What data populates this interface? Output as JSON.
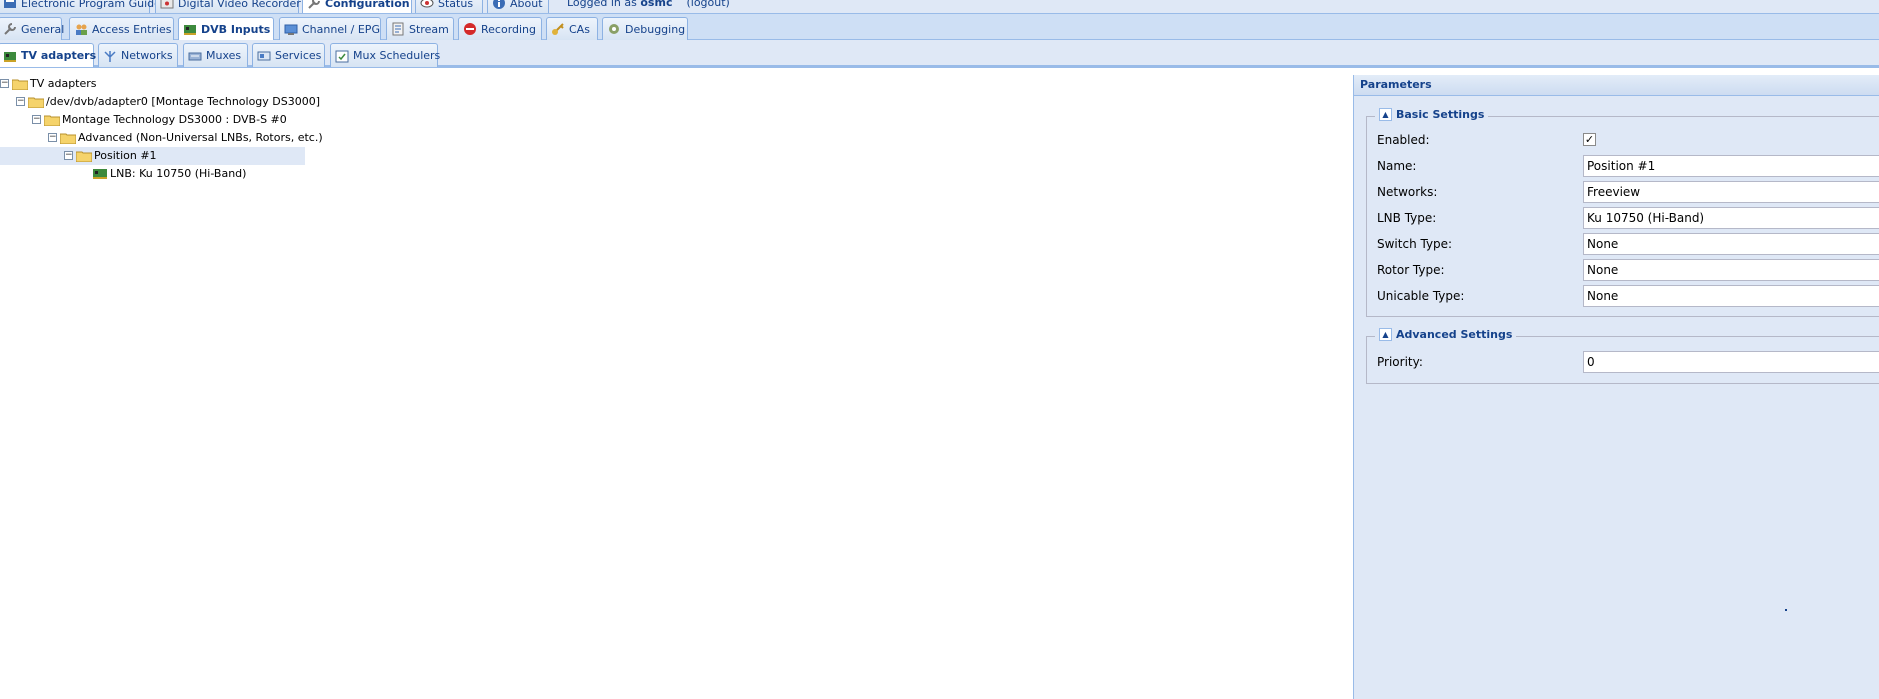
{
  "top_tabs": [
    {
      "label": "Electronic Program Guide",
      "icon": "epg-icon"
    },
    {
      "label": "Digital Video Recorder",
      "icon": "dvr-icon"
    },
    {
      "label": "Configuration",
      "icon": "wrench-icon",
      "active": true
    },
    {
      "label": "Status",
      "icon": "eye-icon"
    },
    {
      "label": "About",
      "icon": "info-icon"
    }
  ],
  "login": {
    "prefix": "Logged in as",
    "user": "osmc",
    "logout": "(logout)"
  },
  "config_tabs": [
    {
      "label": "General",
      "icon": "wrench-icon"
    },
    {
      "label": "Access Entries",
      "icon": "users-icon"
    },
    {
      "label": "DVB Inputs",
      "icon": "dvb-card-icon",
      "active": true
    },
    {
      "label": "Channel / EPG",
      "icon": "tv-icon"
    },
    {
      "label": "Stream",
      "icon": "stream-icon"
    },
    {
      "label": "Recording",
      "icon": "rec-icon"
    },
    {
      "label": "CAs",
      "icon": "key-icon"
    },
    {
      "label": "Debugging",
      "icon": "bug-icon"
    }
  ],
  "dvb_tabs": [
    {
      "label": "TV adapters",
      "icon": "dvb-card-icon",
      "active": true
    },
    {
      "label": "Networks",
      "icon": "antenna-icon"
    },
    {
      "label": "Muxes",
      "icon": "mux-icon"
    },
    {
      "label": "Services",
      "icon": "services-icon"
    },
    {
      "label": "Mux Schedulers",
      "icon": "scheduler-icon"
    }
  ],
  "tree": [
    {
      "label": "TV adapters",
      "depth": 0,
      "toggle": "minus",
      "type": "folder"
    },
    {
      "label": "/dev/dvb/adapter0 [Montage Technology DS3000]",
      "depth": 1,
      "toggle": "minus",
      "type": "folder"
    },
    {
      "label": "Montage Technology DS3000 : DVB-S #0",
      "depth": 2,
      "toggle": "minus",
      "type": "folder"
    },
    {
      "label": "Advanced (Non-Universal LNBs, Rotors, etc.)",
      "depth": 3,
      "toggle": "minus",
      "type": "folder"
    },
    {
      "label": "Position #1",
      "depth": 4,
      "toggle": "minus",
      "type": "folder",
      "selected": true
    },
    {
      "label": "LNB: Ku 10750 (Hi-Band)",
      "depth": 5,
      "toggle": "none",
      "type": "card"
    }
  ],
  "parameters": {
    "title": "Parameters",
    "basic": {
      "legend": "Basic Settings",
      "enabled_label": "Enabled:",
      "enabled": true,
      "name_label": "Name:",
      "name_value": "Position #1",
      "networks_label": "Networks:",
      "networks_value": "Freeview",
      "lnb_label": "LNB Type:",
      "lnb_value": "Ku 10750 (Hi-Band)",
      "switch_label": "Switch Type:",
      "switch_value": "None",
      "rotor_label": "Rotor Type:",
      "rotor_value": "None",
      "unicable_label": "Unicable Type:",
      "unicable_value": "None"
    },
    "advanced": {
      "legend": "Advanced Settings",
      "priority_label": "Priority:",
      "priority_value": "0"
    }
  },
  "colors": {
    "accent": "#15428b",
    "border": "#99bbe8",
    "panel_bg": "#dfe8f6",
    "selection": "#dfe8f6"
  }
}
